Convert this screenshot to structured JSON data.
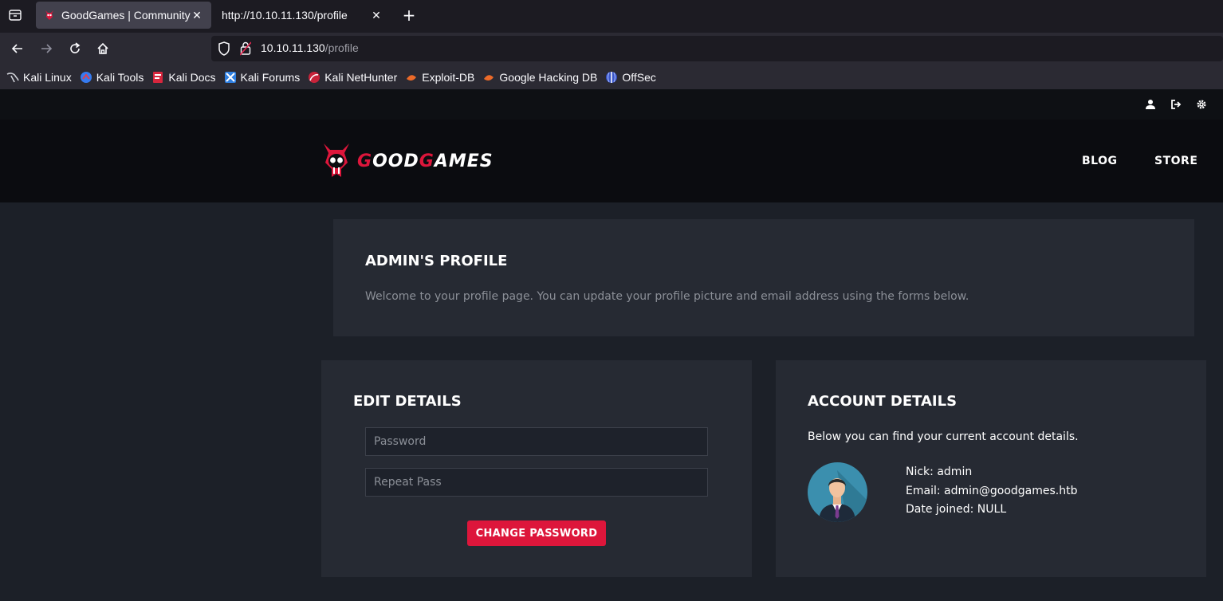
{
  "browser": {
    "tabs": [
      {
        "title": "GoodGames | Community and Store",
        "active": true
      },
      {
        "title": "http://10.10.11.130/profile",
        "active": false
      }
    ],
    "url_host": "10.10.11.130",
    "url_path": "/profile",
    "bookmarks": [
      {
        "label": "Kali Linux",
        "icon": "kali-dragon-icon"
      },
      {
        "label": "Kali Tools",
        "icon": "kali-tools-icon"
      },
      {
        "label": "Kali Docs",
        "icon": "kali-docs-icon"
      },
      {
        "label": "Kali Forums",
        "icon": "kali-forums-icon"
      },
      {
        "label": "Kali NetHunter",
        "icon": "kali-nethunter-icon"
      },
      {
        "label": "Exploit-DB",
        "icon": "exploit-db-icon"
      },
      {
        "label": "Google Hacking DB",
        "icon": "ghdb-icon"
      },
      {
        "label": "OffSec",
        "icon": "offsec-icon"
      }
    ]
  },
  "site": {
    "brand_first": "G",
    "brand_mid": "OOD",
    "brand_g2": "G",
    "brand_rest": "AMES",
    "nav": {
      "blog": "BLOG",
      "store": "STORE"
    },
    "accent": "#dd163b"
  },
  "profile": {
    "title": "ADMIN'S PROFILE",
    "welcome": "Welcome to your profile page. You can update your profile picture and email address using the forms below."
  },
  "edit": {
    "title": "EDIT DETAILS",
    "password_placeholder": "Password",
    "repeat_placeholder": "Repeat Pass",
    "button": "CHANGE PASSWORD"
  },
  "account": {
    "title": "ACCOUNT DETAILS",
    "intro": "Below you can find your current account details.",
    "nick": "Nick: admin",
    "email": "Email: admin@goodgames.htb",
    "joined": "Date joined: NULL"
  }
}
